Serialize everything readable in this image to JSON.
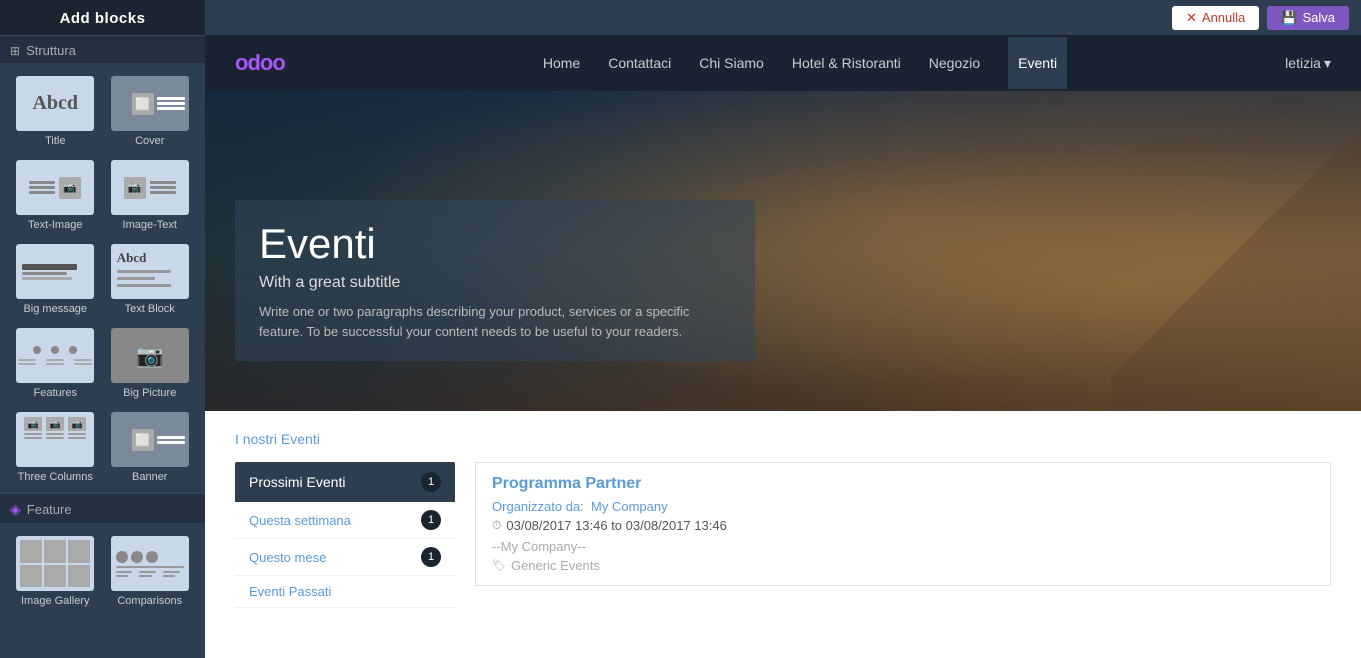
{
  "sidebar": {
    "header": "Add blocks",
    "sections": [
      {
        "id": "struttura",
        "label": "Struttura",
        "icon": "⊞",
        "blocks": [
          {
            "id": "title",
            "label": "Title",
            "thumb": "title"
          },
          {
            "id": "cover",
            "label": "Cover",
            "thumb": "cover"
          },
          {
            "id": "text-image",
            "label": "Text-Image",
            "thumb": "text-image"
          },
          {
            "id": "image-text",
            "label": "Image-Text",
            "thumb": "image-text"
          },
          {
            "id": "big-message",
            "label": "Big message",
            "thumb": "bigmsg"
          },
          {
            "id": "text-block",
            "label": "Text Block",
            "thumb": "textblock"
          },
          {
            "id": "features",
            "label": "Features",
            "thumb": "features"
          },
          {
            "id": "big-picture",
            "label": "Big Picture",
            "thumb": "bigpic"
          },
          {
            "id": "three-columns",
            "label": "Three Columns",
            "thumb": "threecol"
          },
          {
            "id": "banner",
            "label": "Banner",
            "thumb": "banner"
          }
        ]
      },
      {
        "id": "feature",
        "label": "Feature",
        "icon": "◈",
        "blocks": [
          {
            "id": "image-gallery",
            "label": "Image Gallery",
            "thumb": "imgallery"
          },
          {
            "id": "comparisons",
            "label": "Comparisons",
            "thumb": "comparisons"
          }
        ]
      }
    ]
  },
  "topbar": {
    "cancel_label": "Annulla",
    "save_label": "Salva"
  },
  "nav": {
    "logo": "odoo",
    "links": [
      {
        "label": "Home"
      },
      {
        "label": "Contattaci"
      },
      {
        "label": "Chi Siamo"
      },
      {
        "label": "Hotel & Ristoranti"
      },
      {
        "label": "Negozio"
      },
      {
        "label": "Eventi",
        "active": true
      }
    ],
    "user": "letizia"
  },
  "hero": {
    "title": "Eventi",
    "subtitle": "With a great subtitle",
    "description": "Write one or two paragraphs describing your product, services or a specific feature. To be successful your content needs to be useful to your readers."
  },
  "events": {
    "section_title": "I nostri Eventi",
    "filters": {
      "header": "Prossimi Eventi",
      "header_count": "1",
      "items": [
        {
          "label": "Questa settimana",
          "count": "1"
        },
        {
          "label": "Questo mese",
          "count": "1"
        },
        {
          "label": "Eventi Passati",
          "count": ""
        }
      ]
    },
    "featured_event": {
      "title": "Programma Partner",
      "organizer_label": "Organizzato da:",
      "organizer": "My Company",
      "date": "03/08/2017 13:46 to 03/08/2017 13:46",
      "company": "--My Company--",
      "tags": "Generic Events"
    }
  }
}
